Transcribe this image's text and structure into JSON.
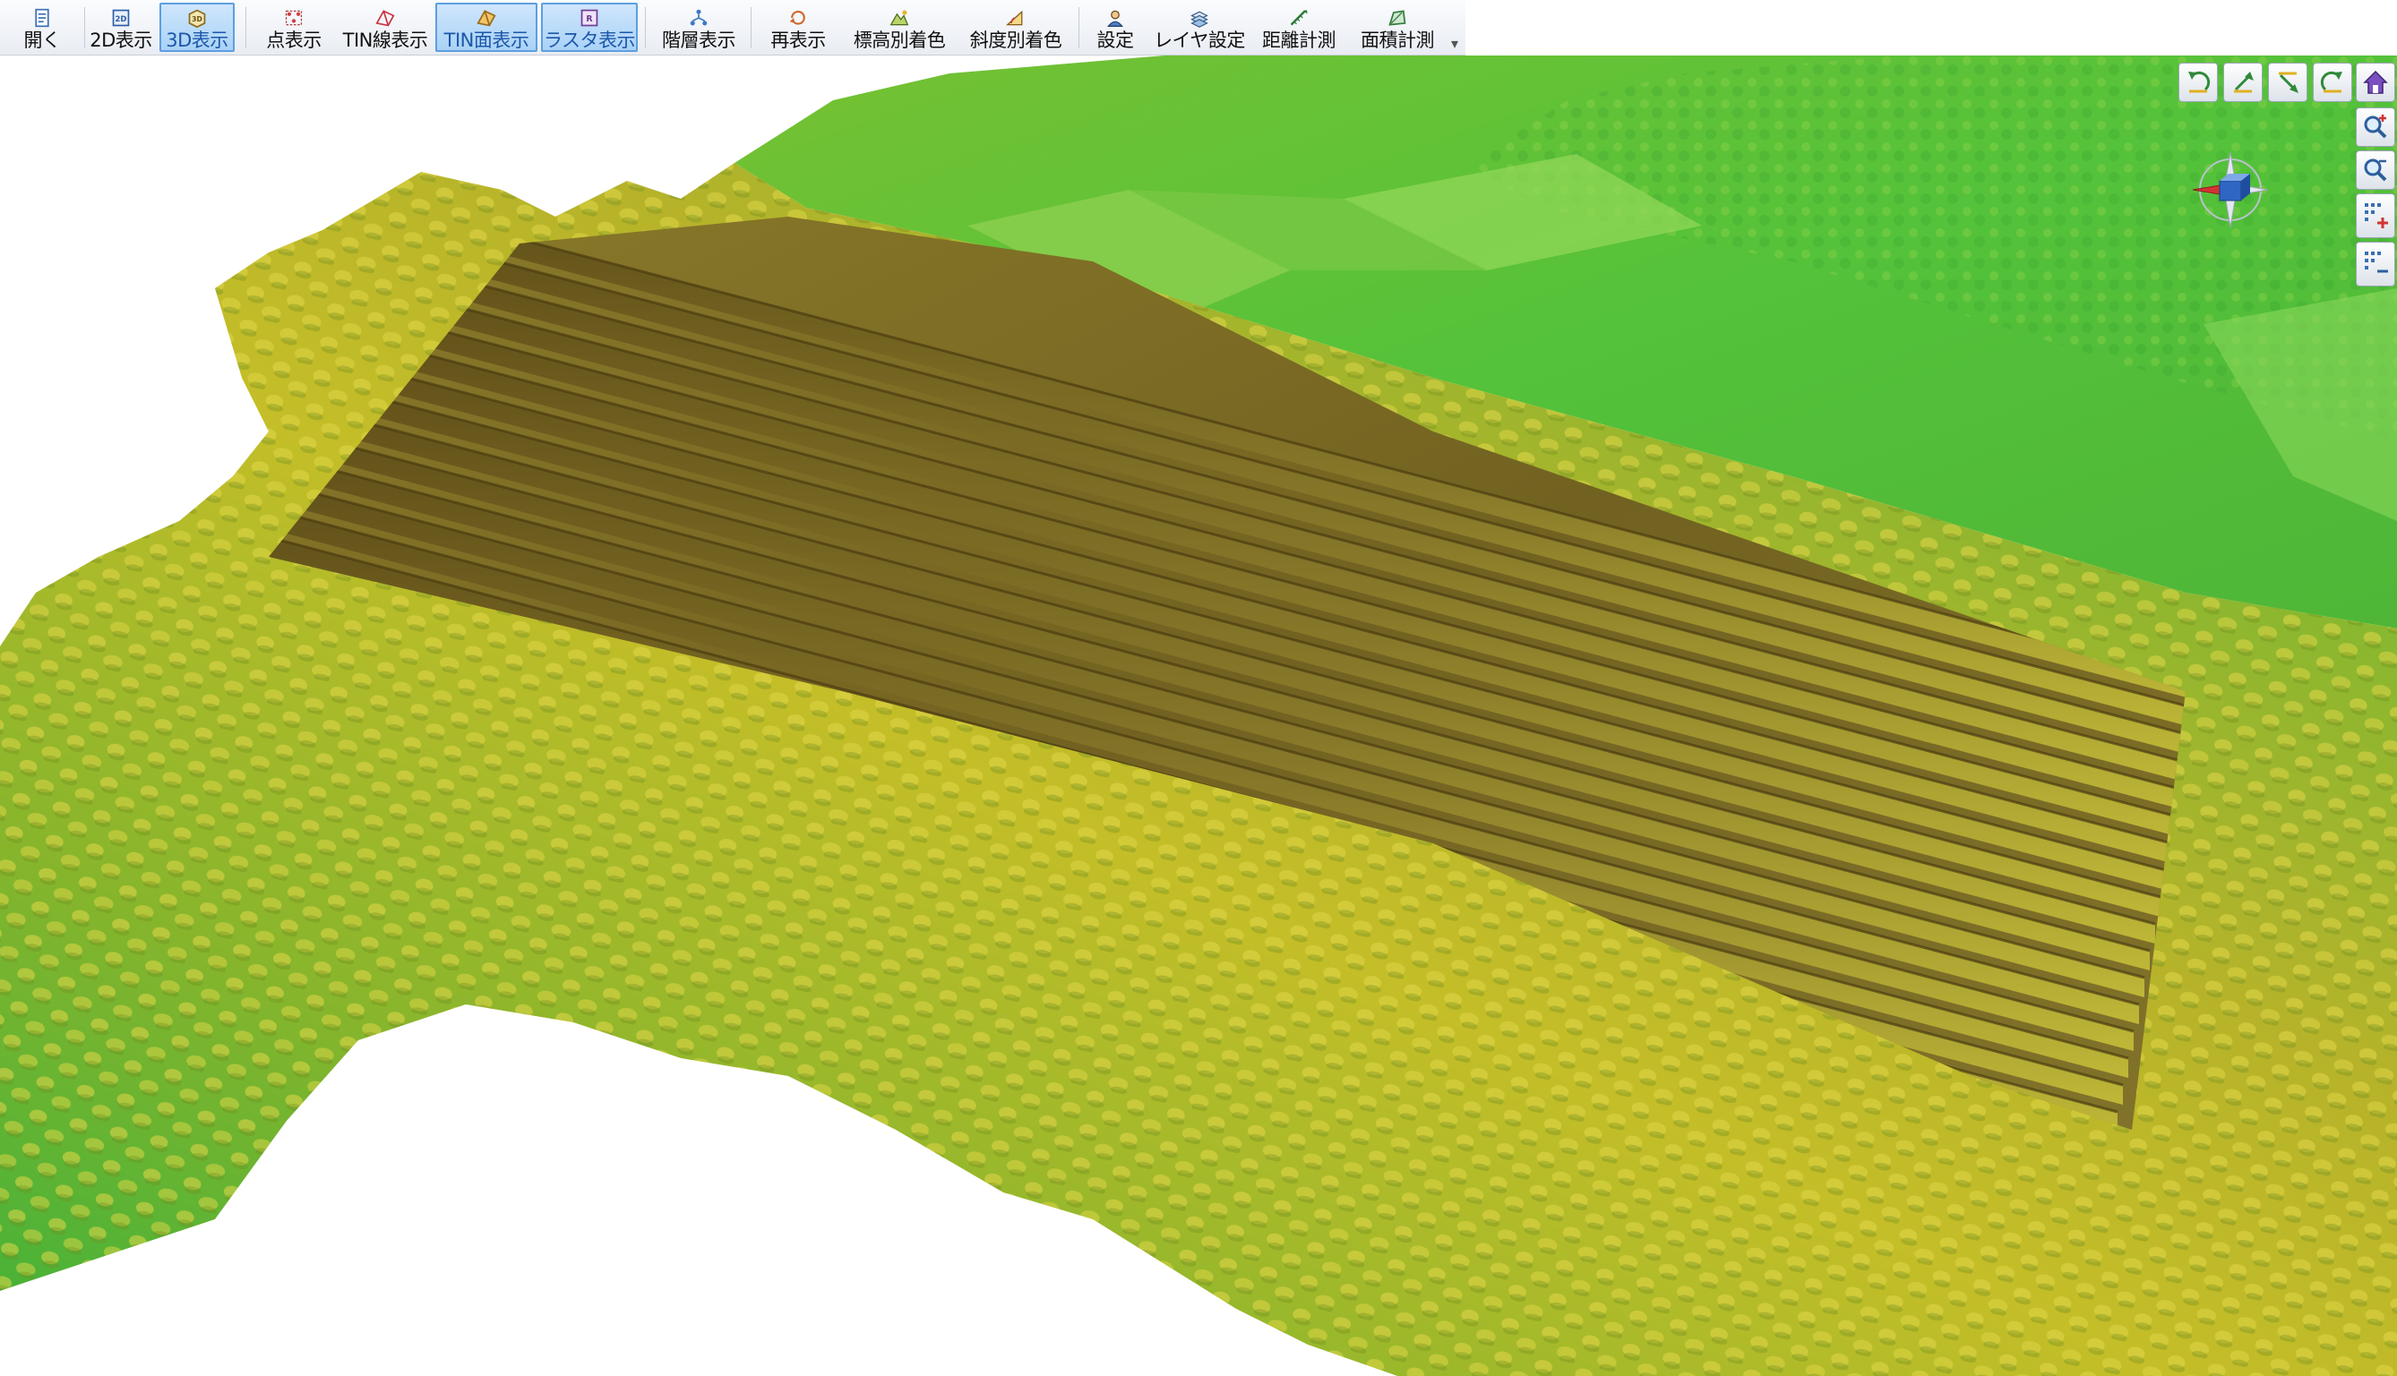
{
  "toolbar": {
    "open": "開く",
    "view_2d": "2D表示",
    "view_3d": "3D表示",
    "points": "点表示",
    "tin_lines": "TIN線表示",
    "tin_faces": "TIN面表示",
    "raster": "ラスタ表示",
    "layers": "階層表示",
    "redraw": "再表示",
    "elevation_color": "標高別着色",
    "slope_color": "斜度別着色",
    "settings": "設定",
    "layer_settings": "レイヤ設定",
    "distance": "距離計測",
    "area": "面積計測",
    "active_buttons": [
      "3D表示",
      "TIN面表示",
      "ラスタ表示"
    ]
  },
  "nav": {
    "buttons": [
      "rotate-left-icon",
      "tilt-up-icon",
      "tilt-down-icon",
      "rotate-right-icon",
      "home-icon",
      "zoom-in-icon",
      "zoom-out-icon",
      "height-up-icon",
      "height-down-icon"
    ]
  },
  "colors": {
    "accent": "#5d9fe0",
    "terrain_low": "#3fb43a",
    "terrain_mid": "#c9c027",
    "terrain_high": "#6b5a1e"
  }
}
